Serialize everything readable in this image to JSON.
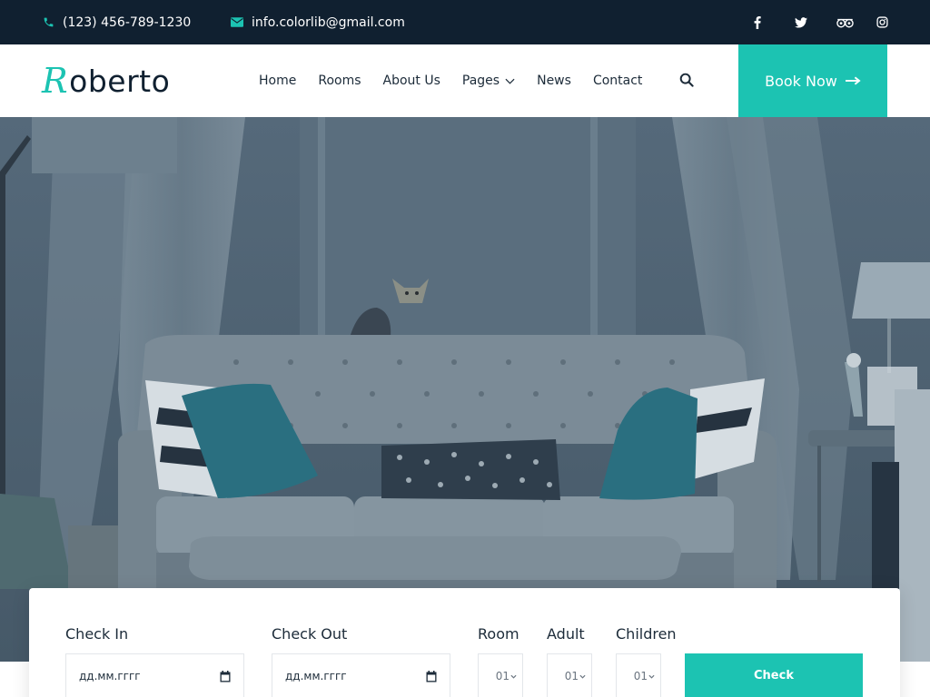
{
  "topbar": {
    "phone": "(123) 456-789-1230",
    "email": "info.colorlib@gmail.com",
    "social": [
      "facebook-icon",
      "twitter-icon",
      "tripadvisor-icon",
      "instagram-icon"
    ]
  },
  "header": {
    "logo_initial": "R",
    "logo_rest": "oberto",
    "nav": [
      "Home",
      "Rooms",
      "About Us",
      "Pages",
      "News",
      "Contact"
    ],
    "book_now": "Book Now"
  },
  "booking": {
    "check_in_label": "Check In",
    "check_in_value": "дд.мм.гггг",
    "check_out_label": "Check Out",
    "check_out_value": "дд.мм.гггг",
    "room_label": "Room",
    "room_value": "01",
    "adult_label": "Adult",
    "adult_value": "01",
    "children_label": "Children",
    "children_value": "01",
    "check_button": "Check"
  },
  "colors": {
    "accent": "#1cc3b2",
    "topbar_bg": "#102030",
    "text_dark": "#1c2b39"
  }
}
